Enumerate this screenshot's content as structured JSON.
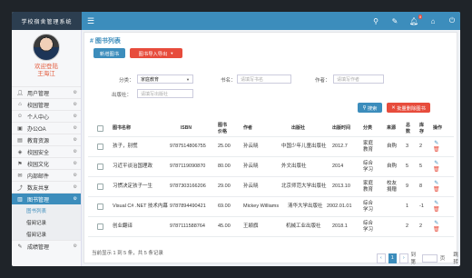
{
  "brand": "学校宿舍管理系统",
  "user": {
    "welcome": "欢迎登陆",
    "name": "王海江"
  },
  "header_badge": "9",
  "sidebar": {
    "items": [
      {
        "label": "用户管理",
        "icon": "user-icon"
      },
      {
        "label": "校园管理",
        "icon": "home-icon"
      },
      {
        "label": "个人中心",
        "icon": "person-icon"
      },
      {
        "label": "办公OA",
        "icon": "briefcase-icon"
      },
      {
        "label": "教育资源",
        "icon": "book-icon"
      },
      {
        "label": "校园安全",
        "icon": "shield-icon"
      },
      {
        "label": "校园文化",
        "icon": "flag-icon"
      },
      {
        "label": "内部邮件",
        "icon": "mail-icon"
      },
      {
        "label": "数友共享",
        "icon": "share-icon"
      },
      {
        "label": "图书管理",
        "icon": "library-icon"
      }
    ],
    "sub_items": [
      "图书列表",
      "借阅记录",
      "借阅记录"
    ],
    "bottom_item": {
      "label": "成绩管理",
      "icon": "grade-icon"
    }
  },
  "page": {
    "title": "# 图书列表"
  },
  "toolbar": {
    "add_label": "新增图书",
    "import_label": "图书导入导出"
  },
  "filters": {
    "category_label": "分类：",
    "category_value": "家庭教育",
    "name_label": "书名：",
    "name_placeholder": "请填写书名",
    "author_label": "作者：",
    "author_placeholder": "请填写作者",
    "publisher_label": "出版社：",
    "publisher_placeholder": "请填写出版社",
    "search_label": "搜索",
    "delete_label": "批量删除图书"
  },
  "table": {
    "headers": [
      "图书名称",
      "ISBN",
      "图书价格",
      "作者",
      "出版社",
      "出版时间",
      "分类",
      "来源",
      "总数",
      "库存",
      "操作"
    ],
    "rows": [
      {
        "name": "孩子，别慌",
        "isbn": "9787514806755",
        "price": "25.00",
        "author": "孙云晓",
        "publisher": "中国少年儿童出版社",
        "date": "2012.7",
        "category": "家庭教育",
        "source": "自购",
        "total": "3",
        "stock": "2"
      },
      {
        "name": "习近平谈治国理政",
        "isbn": "9787119090870",
        "price": "80.00",
        "author": "孙云晓",
        "publisher": "外文出版社",
        "date": "2014",
        "category": "综合学习",
        "source": "自购",
        "total": "5",
        "stock": "5"
      },
      {
        "name": "习惯决定孩子一生",
        "isbn": "9787303166206",
        "price": "29.00",
        "author": "孙云晓",
        "publisher": "北京师范大学出版社",
        "date": "2013.10",
        "category": "家庭教育",
        "source": "校友捐赠",
        "total": "9",
        "stock": "8"
      },
      {
        "name": "Visual C# .NET 技术内幕",
        "isbn": "9787894490421",
        "price": "69.00",
        "author": "Mickey Williams",
        "publisher": "清华大学出版社",
        "date": "2002.01.01",
        "category": "综合学习",
        "source": "",
        "total": "1",
        "stock": "-1"
      },
      {
        "name": "创业翻译",
        "isbn": "9787111588764",
        "price": "45.00",
        "author": "王颖旗",
        "publisher": "机械工业出版社",
        "date": "2018.1",
        "category": "综合学习",
        "source": "",
        "total": "2",
        "stock": "2"
      }
    ]
  },
  "footer": {
    "info": "当前显示 1 到 5 条，共 5 条记录",
    "page_current": "1",
    "prev": "‹",
    "next": "›",
    "jump_label": "到第",
    "jump_suffix": "页",
    "go_label": "跳转"
  },
  "colors": {
    "primary": "#3c8dbc",
    "danger": "#e74c3c",
    "sidebar_header": "#2c3e50"
  }
}
